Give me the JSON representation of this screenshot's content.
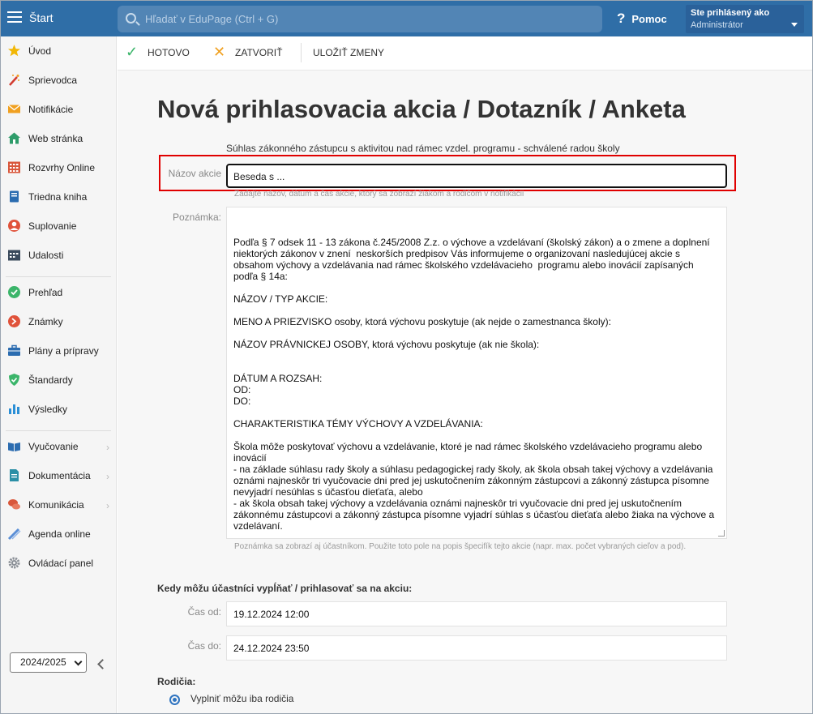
{
  "topbar": {
    "start_label": "Štart",
    "search_placeholder": "Hľadať v EduPage (Ctrl + G)",
    "help_label": "Pomoc",
    "user_label": "Ste prihlásený ako",
    "user_name": "Administrátor"
  },
  "sidebar": {
    "items": [
      {
        "label": "Úvod",
        "icon": "star-icon"
      },
      {
        "label": "Sprievodca",
        "icon": "magic-wand-icon"
      },
      {
        "label": "Notifikácie",
        "icon": "envelope-icon"
      },
      {
        "label": "Web stránka",
        "icon": "house-icon"
      },
      {
        "label": "Rozvrhy Online",
        "icon": "calendar-grid-icon"
      },
      {
        "label": "Triedna kniha",
        "icon": "book-icon"
      },
      {
        "label": "Suplovanie",
        "icon": "person-icon"
      },
      {
        "label": "Udalosti",
        "icon": "calendar-icon"
      },
      {
        "label": "Prehľad",
        "icon": "check-circle-icon"
      },
      {
        "label": "Známky",
        "icon": "grade-icon"
      },
      {
        "label": "Plány a prípravy",
        "icon": "briefcase-icon"
      },
      {
        "label": "Štandardy",
        "icon": "shield-check-icon"
      },
      {
        "label": "Výsledky",
        "icon": "bar-chart-icon"
      },
      {
        "label": "Vyučovanie",
        "icon": "open-book-icon"
      },
      {
        "label": "Dokumentácia",
        "icon": "document-icon"
      },
      {
        "label": "Komunikácia",
        "icon": "chat-icon"
      },
      {
        "label": "Agenda online",
        "icon": "pen-icon"
      },
      {
        "label": "Ovládací panel",
        "icon": "gear-icon"
      }
    ],
    "school_year": "2024/2025"
  },
  "toolbar": {
    "done_label": "HOTOVO",
    "close_label": "ZATVORIŤ",
    "save_label": "ULOŽIŤ ZMENY"
  },
  "form": {
    "title": "Nová prihlasovacia akcia / Dotazník / Anketa",
    "subtitle": "Súhlas zákonného zástupcu s aktivitou nad rámec vzdel. programu - schválené radou školy",
    "name_label": "Názov akcie",
    "name_value": "Beseda s ...",
    "name_hint": "Zadajte názov, dátum a čas akcie, ktorý sa zobrazí žiakom a rodičom v notifikácii",
    "note_label": "Poznámka:",
    "note_value": "Podľa § 7 odsek 11 - 13 zákona č.245/2008 Z.z. o výchove a vzdelávaní (školský zákon) a o zmene a doplnení niektorých zákonov v znení  neskorších predpisov Vás informujeme o organizovaní nasledujúcej akcie s obsahom výchovy a vzdelávania nad rámec školského vzdelávacieho  programu alebo inovácií zapísaných podľa § 14a:\n\nNÁZOV / TYP AKCIE:\n\nMENO A PRIEZVISKO osoby, ktorá výchovu poskytuje (ak nejde o zamestnanca školy):\n\nNÁZOV PRÁVNICKEJ OSOBY, ktorá výchovu poskytuje (ak nie škola):\n\n\nDÁTUM A ROZSAH:\nOD:\nDO:\n\nCHARAKTERISTIKA TÉMY VÝCHOVY A VZDELÁVANIA:\n\nŠkola môže poskytovať výchovu a vzdelávanie, ktoré je nad rámec školského vzdelávacieho programu alebo inovácií\n- na základe súhlasu rady školy a súhlasu pedagogickej rady školy, ak škola obsah takej výchovy a vzdelávania oznámi najneskôr tri vyučovacie dni pred jej uskutočnením zákonným zástupcovi a zákonný zástupca písomne nevyjadrí nesúhlas s účasťou dieťaťa, alebo\n- ak škola obsah takej výchovy a vzdelávania oznámi najneskôr tri vyučovacie dni pred jej uskutočnením zákonnému zástupcovi a zákonný zástupca písomne vyjadrí súhlas s účasťou dieťaťa alebo žiaka na výchove a vzdelávaní.\n\nPre žiaka, ktorý sa výchovy a vzdelávania nezúčastní, riaditeľ školy zabezpečí náhradné školské vyučovanie.",
    "note_hint": "Poznámka sa zobrazí aj účastníkom. Použite toto pole na popis špecifík tejto akcie (napr. max. počet vybraných cieľov a pod).",
    "when_label": "Kedy môžu účastníci vypĺňať / prihlasovať sa na akciu:",
    "from_label": "Čas od:",
    "from_value": "19.12.2024 12:00",
    "to_label": "Čas do:",
    "to_value": "24.12.2024 23:50",
    "parents_label": "Rodičia:",
    "parents_option": "Vyplniť môžu iba rodičia"
  },
  "colors": {
    "topbar": "#2f6ea7",
    "highlight": "#e00000",
    "radio": "#2f74c0"
  }
}
